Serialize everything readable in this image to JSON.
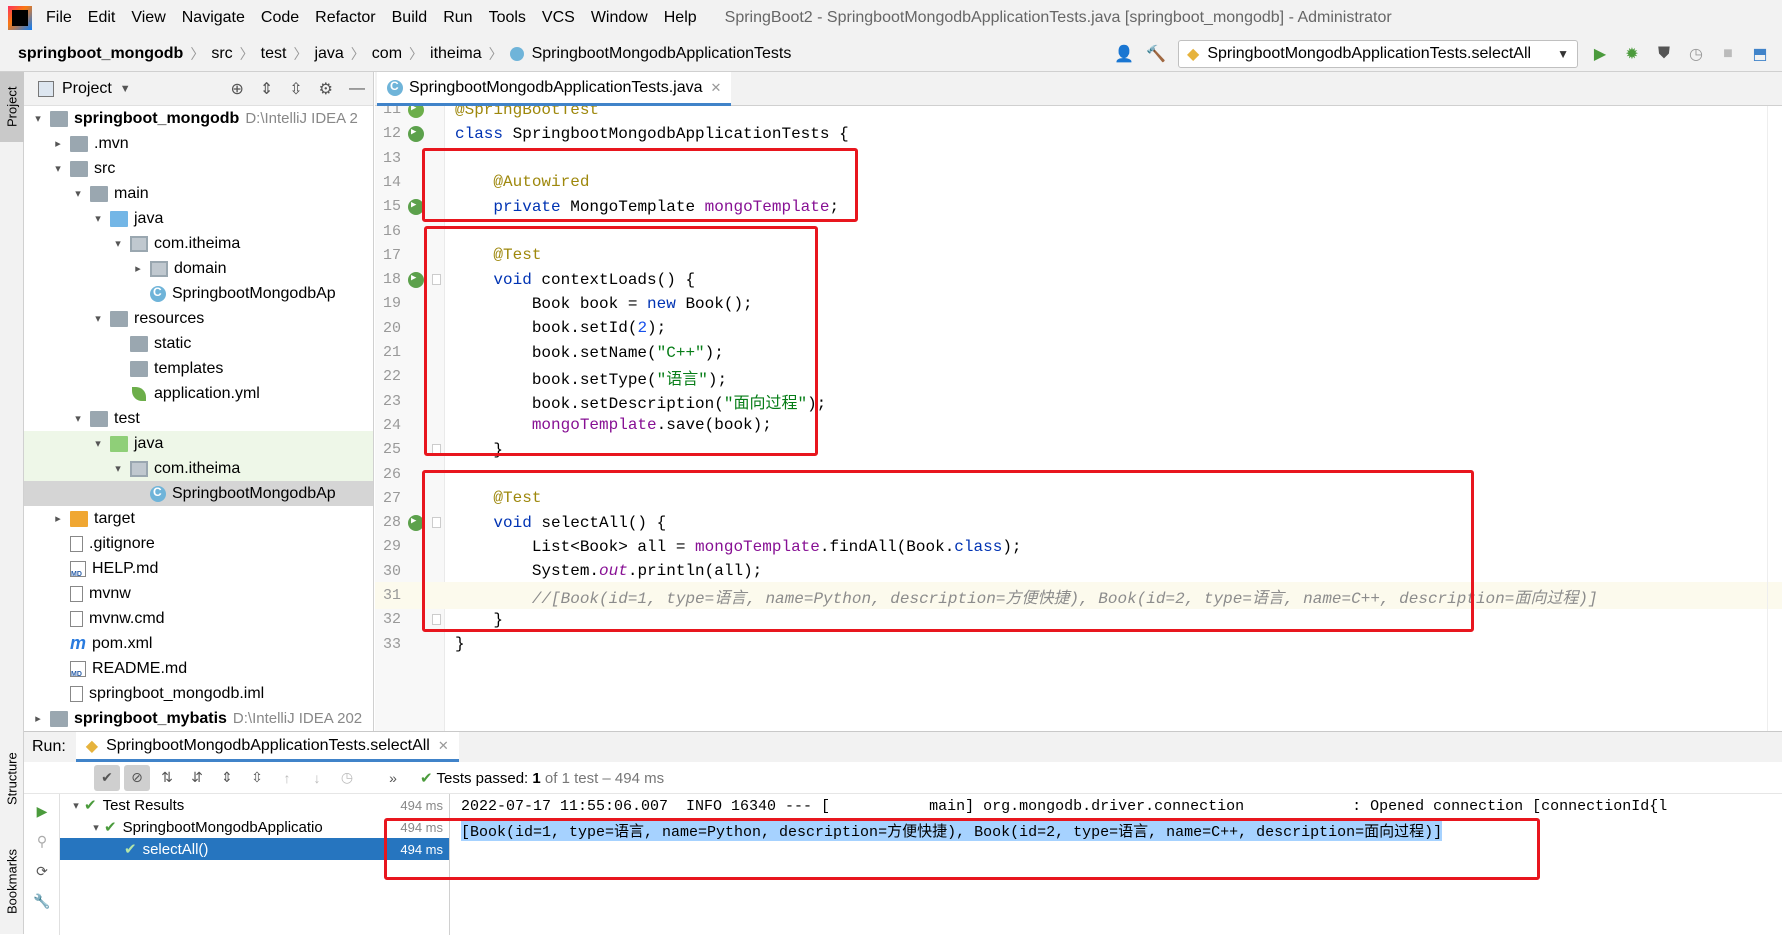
{
  "window": {
    "title": "SpringBoot2 - SpringbootMongodbApplicationTests.java [springboot_mongodb] - Administrator",
    "menu": [
      "File",
      "Edit",
      "View",
      "Navigate",
      "Code",
      "Refactor",
      "Build",
      "Run",
      "Tools",
      "VCS",
      "Window",
      "Help"
    ]
  },
  "breadcrumb": [
    "springboot_mongodb",
    "src",
    "test",
    "java",
    "com",
    "itheima",
    "SpringbootMongodbApplicationTests"
  ],
  "run_config": "SpringbootMongodbApplicationTests.selectAll",
  "side_tabs": {
    "project": "Project",
    "structure": "Structure",
    "bookmarks": "Bookmarks"
  },
  "project_panel": {
    "title": "Project",
    "tree": [
      {
        "label": "springboot_mongodb",
        "extra": "D:\\IntelliJ IDEA 2",
        "arrow": "▾",
        "icon": "folder",
        "bold": true
      },
      {
        "label": ".mvn",
        "arrow": "▸",
        "icon": "folder"
      },
      {
        "label": "src",
        "arrow": "▾",
        "icon": "folder"
      },
      {
        "label": "main",
        "arrow": "▾",
        "icon": "folder"
      },
      {
        "label": "java",
        "arrow": "▾",
        "icon": "folder blue"
      },
      {
        "label": "com.itheima",
        "arrow": "▾",
        "icon": "pkg"
      },
      {
        "label": "domain",
        "arrow": "▸",
        "icon": "pkg"
      },
      {
        "label": "SpringbootMongodbAp",
        "arrow": "",
        "icon": "cls"
      },
      {
        "label": "resources",
        "arrow": "▾",
        "icon": "folder"
      },
      {
        "label": "static",
        "arrow": "",
        "icon": "folder"
      },
      {
        "label": "templates",
        "arrow": "",
        "icon": "folder"
      },
      {
        "label": "application.yml",
        "arrow": "",
        "icon": "leaf"
      },
      {
        "label": "test",
        "arrow": "▾",
        "icon": "folder"
      },
      {
        "label": "java",
        "arrow": "▾",
        "icon": "folder green"
      },
      {
        "label": "com.itheima",
        "arrow": "▾",
        "icon": "pkg"
      },
      {
        "label": "SpringbootMongodbAp",
        "arrow": "",
        "icon": "cls"
      },
      {
        "label": "target",
        "arrow": "▸",
        "icon": "folder orange"
      },
      {
        "label": ".gitignore",
        "arrow": "",
        "icon": "file"
      },
      {
        "label": "HELP.md",
        "arrow": "",
        "icon": "md"
      },
      {
        "label": "mvnw",
        "arrow": "",
        "icon": "file"
      },
      {
        "label": "mvnw.cmd",
        "arrow": "",
        "icon": "file"
      },
      {
        "label": "pom.xml",
        "arrow": "",
        "icon": "mvn"
      },
      {
        "label": "README.md",
        "arrow": "",
        "icon": "md"
      },
      {
        "label": "springboot_mongodb.iml",
        "arrow": "",
        "icon": "file"
      },
      {
        "label": "springboot_mybatis",
        "extra": "D:\\IntelliJ IDEA 202",
        "arrow": "▸",
        "icon": "folder",
        "bold": true
      }
    ]
  },
  "editor": {
    "tab": "SpringbootMongodbApplicationTests.java",
    "lines": [
      {
        "n": "11",
        "html": "<span class='ann'>@SpringBootTest</span>"
      },
      {
        "n": "12",
        "html": "<span class='kw'>class</span> SpringbootMongodbApplicationTests {"
      },
      {
        "n": "13",
        "html": ""
      },
      {
        "n": "14",
        "html": "    <span class='ann'>@Autowired</span>"
      },
      {
        "n": "15",
        "html": "    <span class='kw'>private</span> MongoTemplate <span class='fld'>mongoTemplate</span>;"
      },
      {
        "n": "16",
        "html": ""
      },
      {
        "n": "17",
        "html": "    <span class='ann'>@Test</span>"
      },
      {
        "n": "18",
        "html": "    <span class='kw'>void</span> contextLoads() {"
      },
      {
        "n": "19",
        "html": "        Book book = <span class='kw'>new</span> Book();"
      },
      {
        "n": "20",
        "html": "        book.setId(<span class='num'>2</span>);"
      },
      {
        "n": "21",
        "html": "        book.setName(<span class='str'>\"C++\"</span>);"
      },
      {
        "n": "22",
        "html": "        book.setType(<span class='str'>\"语言\"</span>);"
      },
      {
        "n": "23",
        "html": "        book.setDescription(<span class='str'>\"面向过程\"</span>);"
      },
      {
        "n": "24",
        "html": "        <span class='fld'>mongoTemplate</span>.save(book);"
      },
      {
        "n": "25",
        "html": "    }"
      },
      {
        "n": "26",
        "html": ""
      },
      {
        "n": "27",
        "html": "    <span class='ann'>@Test</span>"
      },
      {
        "n": "28",
        "html": "    <span class='kw'>void</span> selectAll() {"
      },
      {
        "n": "29",
        "html": "        List&lt;Book&gt; all = <span class='fld'>mongoTemplate</span>.findAll(Book.<span class='kw'>class</span>);"
      },
      {
        "n": "30",
        "html": "        System.<span class='fld' style='font-style:italic'>out</span>.println(all);"
      },
      {
        "n": "31",
        "html": "        <span class='cmt'>//[Book(id=1, type=语言, name=Python, description=方便快捷), Book(id=2, type=语言, name=C++, description=面向过程)]</span>"
      },
      {
        "n": "32",
        "html": "    }"
      },
      {
        "n": "33",
        "html": "}"
      }
    ]
  },
  "run_panel": {
    "label": "Run:",
    "tab": "SpringbootMongodbApplicationTests.selectAll",
    "tests_passed": "Tests passed:",
    "tests_count": "1",
    "tests_detail": "of 1 test – 494 ms",
    "tree": [
      {
        "label": "Test Results",
        "time": "494 ms"
      },
      {
        "label": "SpringbootMongodbApplicatio",
        "time": "494 ms"
      },
      {
        "label": "selectAll()",
        "time": "494 ms"
      }
    ],
    "console": [
      "2022-07-17 11:55:06.007  INFO 16340 --- [           main] org.mongodb.driver.connection            : Opened connection [connectionId{l",
      "[Book(id=1, type=语言, name=Python, description=方便快捷), Book(id=2, type=语言, name=C++, description=面向过程)]"
    ]
  }
}
